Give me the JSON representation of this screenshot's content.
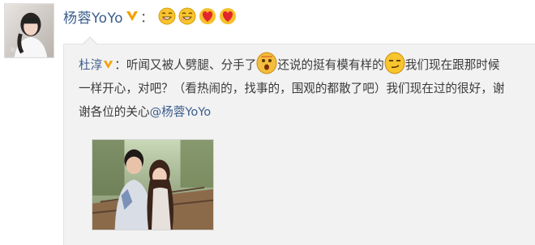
{
  "post": {
    "author": "杨蓉YoYo",
    "colon": "：",
    "emojis": [
      "grin-icon",
      "grin-icon",
      "heart-icon",
      "heart-icon"
    ]
  },
  "repost": {
    "author": "杜淳",
    "author_sep": "：",
    "text_1": "听闻又被人劈腿、分手了",
    "text_2": "还说的挺有模有样的",
    "text_3": "我们现在跟那时候",
    "text_4": "一样开心，对吧？（看热闹的，找事的，围观的都散了吧）我们现在过的很好，谢",
    "text_5": "谢各位的关心",
    "mention": "@杨蓉YoYo"
  },
  "colors": {
    "link": "#3b5d8c",
    "repost_bg": "#f2f2f2",
    "verified_badge": "#f4a000"
  }
}
